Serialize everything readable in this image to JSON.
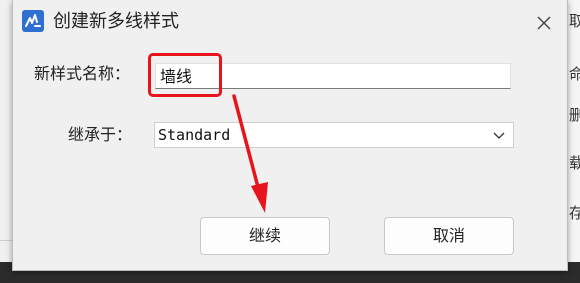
{
  "dialog": {
    "title": "创建新多线样式",
    "name_label": "新样式名称：",
    "name_value": "墙线",
    "inherit_label": "继承于：",
    "inherit_value": "Standard",
    "continue_label": "继续",
    "cancel_label": "取消"
  },
  "background": {
    "chars": [
      "取",
      "命",
      "删",
      "载",
      "存"
    ]
  },
  "colors": {
    "highlight": "#e8141b",
    "app_icon": "#2f6fd1"
  },
  "icons": {
    "app": "app-logo-icon",
    "close": "close-icon",
    "dropdown": "chevron-down-icon"
  }
}
